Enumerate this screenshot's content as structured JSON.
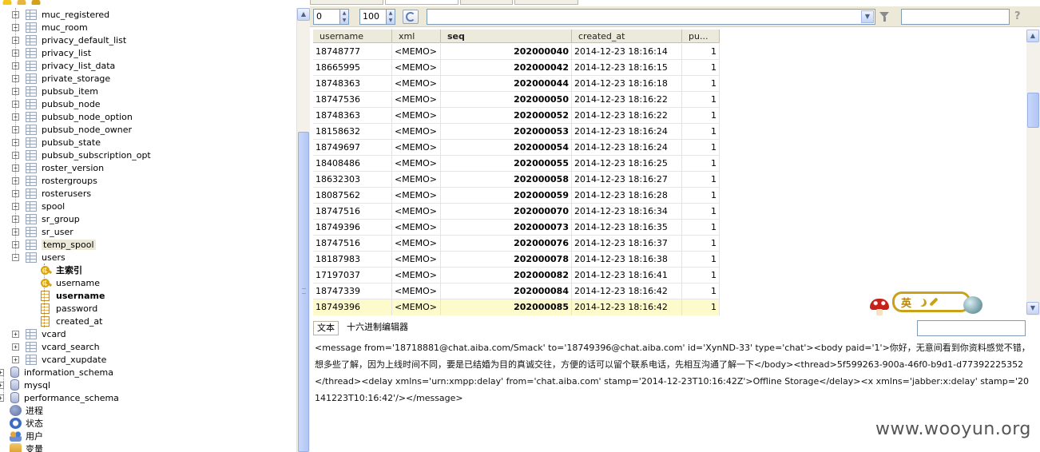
{
  "tree": {
    "items": [
      {
        "label": "muc_registered",
        "type": "table"
      },
      {
        "label": "muc_room",
        "type": "table"
      },
      {
        "label": "privacy_default_list",
        "type": "table"
      },
      {
        "label": "privacy_list",
        "type": "table"
      },
      {
        "label": "privacy_list_data",
        "type": "table"
      },
      {
        "label": "private_storage",
        "type": "table"
      },
      {
        "label": "pubsub_item",
        "type": "table"
      },
      {
        "label": "pubsub_node",
        "type": "table"
      },
      {
        "label": "pubsub_node_option",
        "type": "table"
      },
      {
        "label": "pubsub_node_owner",
        "type": "table"
      },
      {
        "label": "pubsub_state",
        "type": "table"
      },
      {
        "label": "pubsub_subscription_opt",
        "type": "table"
      },
      {
        "label": "roster_version",
        "type": "table"
      },
      {
        "label": "rostergroups",
        "type": "table"
      },
      {
        "label": "rosterusers",
        "type": "table"
      },
      {
        "label": "spool",
        "type": "table"
      },
      {
        "label": "sr_group",
        "type": "table"
      },
      {
        "label": "sr_user",
        "type": "table"
      },
      {
        "label": "temp_spool",
        "type": "table"
      },
      {
        "label": "users",
        "type": "table"
      }
    ],
    "users_children": [
      {
        "label": "主索引",
        "type": "key",
        "bold": true
      },
      {
        "label": "username",
        "type": "key",
        "bold": false
      },
      {
        "label": "username",
        "type": "column",
        "bold": true
      },
      {
        "label": "password",
        "type": "column",
        "bold": false
      },
      {
        "label": "created_at",
        "type": "column",
        "bold": false
      }
    ],
    "after_items": [
      {
        "label": "vcard",
        "type": "table"
      },
      {
        "label": "vcard_search",
        "type": "table"
      },
      {
        "label": "vcard_xupdate",
        "type": "table"
      }
    ],
    "databases": [
      {
        "label": "information_schema"
      },
      {
        "label": "mysql"
      },
      {
        "label": "performance_schema"
      }
    ],
    "bottom": [
      {
        "label": "进程",
        "icon": "process-icon"
      },
      {
        "label": "状态",
        "icon": "status-icon"
      },
      {
        "label": "用户",
        "icon": "users-icon"
      },
      {
        "label": "变量",
        "icon": "variables-icon"
      }
    ]
  },
  "toolbar": {
    "offset_value": "0",
    "limit_value": "100",
    "filter_value": ""
  },
  "grid": {
    "columns": [
      "username",
      "xml",
      "seq",
      "created_at",
      "pu..."
    ],
    "rows": [
      [
        "18748777",
        "<MEMO>",
        "202000040",
        "2014-12-23 18:16:14",
        "1"
      ],
      [
        "18665995",
        "<MEMO>",
        "202000042",
        "2014-12-23 18:16:15",
        "1"
      ],
      [
        "18748363",
        "<MEMO>",
        "202000044",
        "2014-12-23 18:16:18",
        "1"
      ],
      [
        "18747536",
        "<MEMO>",
        "202000050",
        "2014-12-23 18:16:22",
        "1"
      ],
      [
        "18748363",
        "<MEMO>",
        "202000052",
        "2014-12-23 18:16:22",
        "1"
      ],
      [
        "18158632",
        "<MEMO>",
        "202000053",
        "2014-12-23 18:16:24",
        "1"
      ],
      [
        "18749697",
        "<MEMO>",
        "202000054",
        "2014-12-23 18:16:24",
        "1"
      ],
      [
        "18408486",
        "<MEMO>",
        "202000055",
        "2014-12-23 18:16:25",
        "1"
      ],
      [
        "18632303",
        "<MEMO>",
        "202000058",
        "2014-12-23 18:16:27",
        "1"
      ],
      [
        "18087562",
        "<MEMO>",
        "202000059",
        "2014-12-23 18:16:28",
        "1"
      ],
      [
        "18747516",
        "<MEMO>",
        "202000070",
        "2014-12-23 18:16:34",
        "1"
      ],
      [
        "18749396",
        "<MEMO>",
        "202000073",
        "2014-12-23 18:16:35",
        "1"
      ],
      [
        "18747516",
        "<MEMO>",
        "202000076",
        "2014-12-23 18:16:37",
        "1"
      ],
      [
        "18187983",
        "<MEMO>",
        "202000078",
        "2014-12-23 18:16:38",
        "1"
      ],
      [
        "17197037",
        "<MEMO>",
        "202000082",
        "2014-12-23 18:16:41",
        "1"
      ],
      [
        "18747339",
        "<MEMO>",
        "202000084",
        "2014-12-23 18:16:42",
        "1"
      ],
      [
        "18749396",
        "<MEMO>",
        "202000085",
        "2014-12-23 18:16:42",
        "1"
      ]
    ],
    "selected_row": 16
  },
  "lower": {
    "tab_text": "文本",
    "tab_hex": "十六进制编辑器",
    "message": "<message from='18718881@chat.aiba.com/Smack' to='18749396@chat.aiba.com' id='XynND-33' type='chat'><body paid='1'>你好，无意间看到你资料感觉不错，想多些了解，因为上线时间不同，要是已结婚为目的真诚交往，方便的话可以留个联系电话，先相互沟通了解一下</body><thread>5f599263-900a-46f0-b9d1-d77392225352</thread><delay xmlns='urn:xmpp:delay' from='chat.aiba.com' stamp='2014-12-23T10:16:42Z'>Offline Storage</delay><x xmlns='jabber:x:delay' stamp='20141223T10:16:42'/></message>"
  },
  "ime": {
    "lang": "英"
  },
  "watermark": "www.wooyun.org"
}
